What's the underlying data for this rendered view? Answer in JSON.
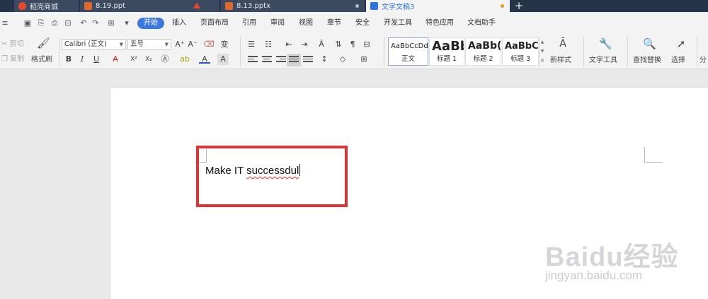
{
  "tabs": [
    {
      "label": "稻壳商城",
      "icon": "daoke-flame-icon",
      "color": "#e2492f"
    },
    {
      "label": "8.19.ppt",
      "icon": "ppt-file-icon",
      "color": "#e2672f"
    },
    {
      "label": "",
      "icon": "warning-icon",
      "color": "#e2492f"
    },
    {
      "label": "8.13.pptx",
      "icon": "ppt-file-icon",
      "color": "#e2672f"
    },
    {
      "label": "文字文稿3",
      "icon": "wps-writer-icon",
      "color": "#2c73e0"
    }
  ],
  "new_tab": "+",
  "menu": {
    "items": [
      "开始",
      "插入",
      "页面布局",
      "引用",
      "审阅",
      "视图",
      "章节",
      "安全",
      "开发工具",
      "特色应用",
      "文档助手"
    ],
    "active": "开始"
  },
  "ribbon": {
    "cut": "剪切",
    "copy": "复制",
    "format_painter": "格式刷",
    "font_name": "Calibri (正文)",
    "font_size": "五号",
    "styles": [
      {
        "sample": "AaBbCcDd",
        "name": "正文"
      },
      {
        "sample": "AaBb",
        "name": "标题 1"
      },
      {
        "sample": "AaBb(",
        "name": "标题 2"
      },
      {
        "sample": "AaBbC",
        "name": "标题 3"
      }
    ],
    "new_style": "新样式",
    "text_tools": "文字工具",
    "find_replace": "查找替换",
    "select": "选择",
    "split": "分"
  },
  "document": {
    "text_prefix": "Make IT ",
    "text_misspelled": "successdul"
  },
  "watermark": {
    "logo": "Baidu经验",
    "url": "jingyan.baidu.com"
  },
  "colors": {
    "accent": "#3c78e0",
    "highlight": "#e03434",
    "tab_bar": "#26344a"
  }
}
